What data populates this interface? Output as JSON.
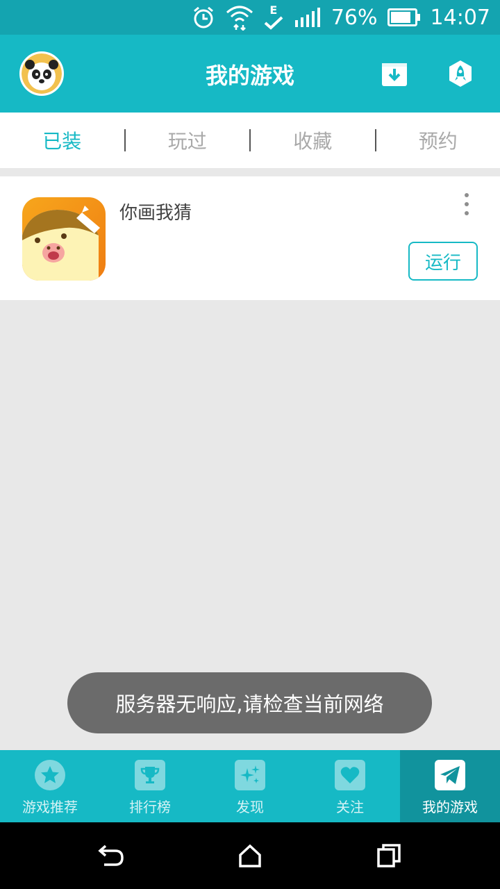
{
  "status_bar": {
    "battery_percent": "76%",
    "time": "14:07",
    "network_label": "E",
    "icons": [
      "alarm-icon",
      "wifi-icon",
      "signal-icon",
      "battery-icon"
    ]
  },
  "header": {
    "title": "我的游戏",
    "buttons": [
      "download-icon",
      "rocket-icon"
    ]
  },
  "tabs": [
    {
      "label": "已装",
      "active": true
    },
    {
      "label": "玩过",
      "active": false
    },
    {
      "label": "收藏",
      "active": false
    },
    {
      "label": "预约",
      "active": false
    }
  ],
  "games": [
    {
      "name": "你画我猜",
      "action_label": "运行"
    }
  ],
  "toast": {
    "message": "服务器无响应,请检查当前网络"
  },
  "bottom_nav": [
    {
      "label": "游戏推荐",
      "icon": "star-icon",
      "active": false
    },
    {
      "label": "排行榜",
      "icon": "trophy-icon",
      "active": false
    },
    {
      "label": "发现",
      "icon": "sparkle-icon",
      "active": false
    },
    {
      "label": "关注",
      "icon": "heart-icon",
      "active": false
    },
    {
      "label": "我的游戏",
      "icon": "paper-plane-icon",
      "active": true
    }
  ],
  "colors": {
    "primary": "#16b9c5",
    "status_bar": "#14a4b0",
    "nav_active": "#11939d",
    "background": "#e8e8e8",
    "toast": "#6b6b6b"
  }
}
